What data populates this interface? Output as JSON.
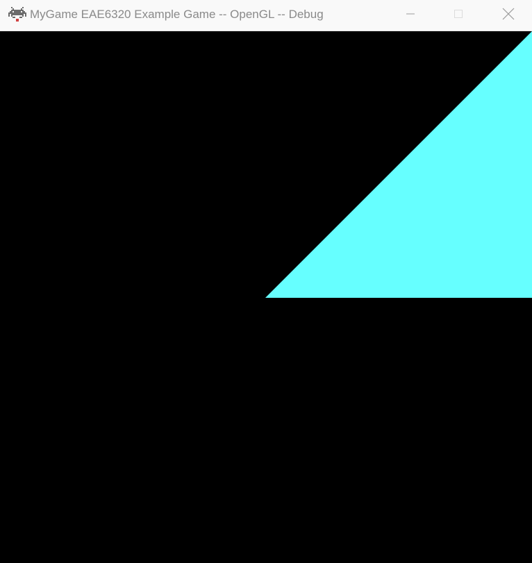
{
  "window": {
    "title": "MyGame EAE6320 Example Game -- OpenGL -- Debug",
    "app_icon": "space-invader-icon",
    "controls": {
      "minimize_icon": "minimize-icon",
      "maximize_icon": "maximize-icon",
      "close_icon": "close-icon"
    }
  },
  "colors": {
    "titlebar_bg": "#f9f9f9",
    "title_text": "#8a8a8a",
    "clear_color": "#000000",
    "triangle_fill": "#66ffff"
  },
  "scene": {
    "shape": "triangle",
    "icon": "triangle-shape"
  }
}
